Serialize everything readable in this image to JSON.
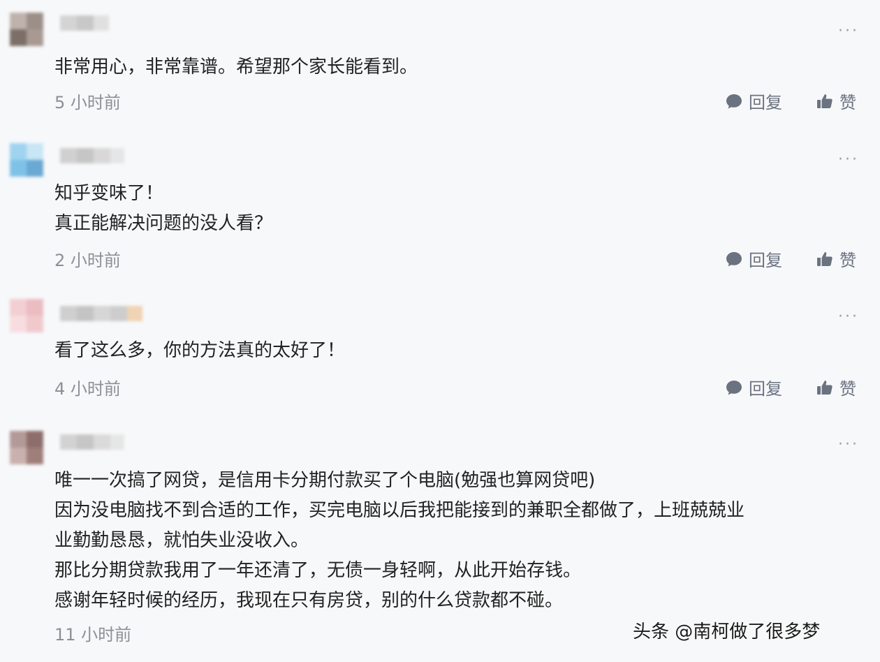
{
  "comments": [
    {
      "lines": [
        "非常用心，非常靠谱。希望那个家长能看到。"
      ],
      "time": "5 小时前",
      "reply_label": "回复",
      "like_label": "赞",
      "more_label": "···"
    },
    {
      "lines": [
        "知乎变味了！",
        "真正能解决问题的没人看？"
      ],
      "time": "2 小时前",
      "reply_label": "回复",
      "like_label": "赞",
      "more_label": "···"
    },
    {
      "lines": [
        "看了这么多，你的方法真的太好了！"
      ],
      "time": "4 小时前",
      "reply_label": "回复",
      "like_label": "赞",
      "more_label": "···"
    },
    {
      "lines": [
        "唯一一次搞了网贷，是信用卡分期付款买了个电脑(勉强也算网贷吧)",
        "因为没电脑找不到合适的工作，买完电脑以后我把能接到的兼职全都做了，上班兢兢业",
        "业勤勤恳恳，就怕失业没收入。",
        "那比分期贷款我用了一年还清了，无债一身轻啊，从此开始存钱。",
        "感谢年轻时候的经历，我现在只有房贷，别的什么贷款都不碰。"
      ],
      "time": "11 小时前",
      "more_label": "···"
    }
  ],
  "watermark": "头条 @南柯做了很多梦",
  "colors": {
    "icon": "#6b7280",
    "time": "#8c8f96",
    "text": "#222222",
    "background": "#f7f8fa"
  }
}
